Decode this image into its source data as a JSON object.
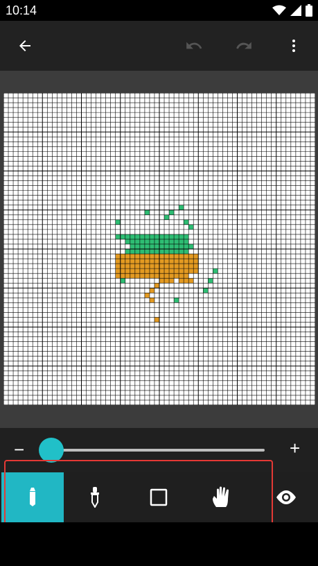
{
  "status": {
    "time": "10:14",
    "icons": [
      "wifi-icon",
      "cell-signal-icon",
      "battery-icon"
    ]
  },
  "appbar": {
    "icons": [
      "back-arrow-icon",
      "undo-icon",
      "redo-icon",
      "more-vert-icon"
    ]
  },
  "canvas": {
    "grid_columns": 64,
    "grid_rows": 64
  },
  "zoom": {
    "minus_label": "−",
    "plus_label": "+",
    "level_fraction": 0.0
  },
  "tools": [
    {
      "name": "pencil-icon",
      "active": true
    },
    {
      "name": "eyedropper-icon",
      "active": false
    },
    {
      "name": "rectangle-icon",
      "active": false
    },
    {
      "name": "hand-icon",
      "active": false
    },
    {
      "name": "eye-icon",
      "active": false
    }
  ],
  "colors": {
    "accent": "#21c0c8",
    "green": "#2ebd73",
    "orange": "#e39a22",
    "highlight": "#e53935"
  }
}
